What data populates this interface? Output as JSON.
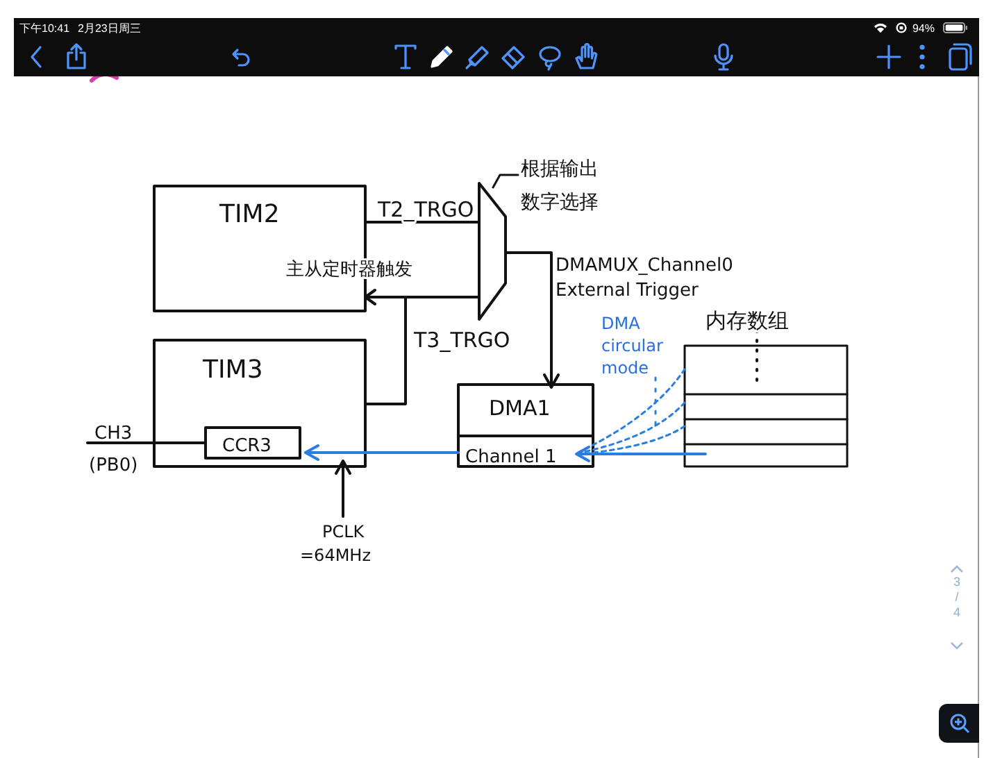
{
  "status_bar": {
    "time": "下午10:41",
    "date": "2月23日周三",
    "battery": "94%"
  },
  "toolbar": {
    "tools": [
      {
        "kind": "text",
        "selected": false
      },
      {
        "kind": "pen",
        "selected": true
      },
      {
        "kind": "highlighter",
        "selected": false
      },
      {
        "kind": "eraser",
        "selected": false
      },
      {
        "kind": "lasso",
        "selected": false
      },
      {
        "kind": "hand",
        "selected": false
      }
    ]
  },
  "note": {
    "labels": [
      {
        "text": "TIM2",
        "color": "#111111"
      },
      {
        "text": "T2_TRGO",
        "color": "#111111"
      },
      {
        "text": "根据输出",
        "color": "#111111"
      },
      {
        "text": "数字选择",
        "color": "#111111"
      },
      {
        "text": "主从定时器触发",
        "color": "#111111"
      },
      {
        "text": "DMAMUX_Channel0",
        "color": "#111111"
      },
      {
        "text": "External Trigger",
        "color": "#111111"
      },
      {
        "text": "T3_TRGO",
        "color": "#111111"
      },
      {
        "text": "TIM3",
        "color": "#111111"
      },
      {
        "text": "DMA",
        "color": "#2a6fdb"
      },
      {
        "text": "circular",
        "color": "#2a6fdb"
      },
      {
        "text": "mode",
        "color": "#2a6fdb"
      },
      {
        "text": "内存数组",
        "color": "#111111"
      },
      {
        "text": "DMA1",
        "color": "#111111"
      },
      {
        "text": "CH3",
        "color": "#111111"
      },
      {
        "text": "CCR3",
        "color": "#111111"
      },
      {
        "text": "(PB0)",
        "color": "#111111"
      },
      {
        "text": "Channel 1",
        "color": "#111111"
      },
      {
        "text": "PCLK",
        "color": "#111111"
      },
      {
        "text": "=64MHz",
        "color": "#111111"
      }
    ]
  },
  "page_indicator": {
    "current": "3",
    "separator": "/",
    "total": "4"
  }
}
